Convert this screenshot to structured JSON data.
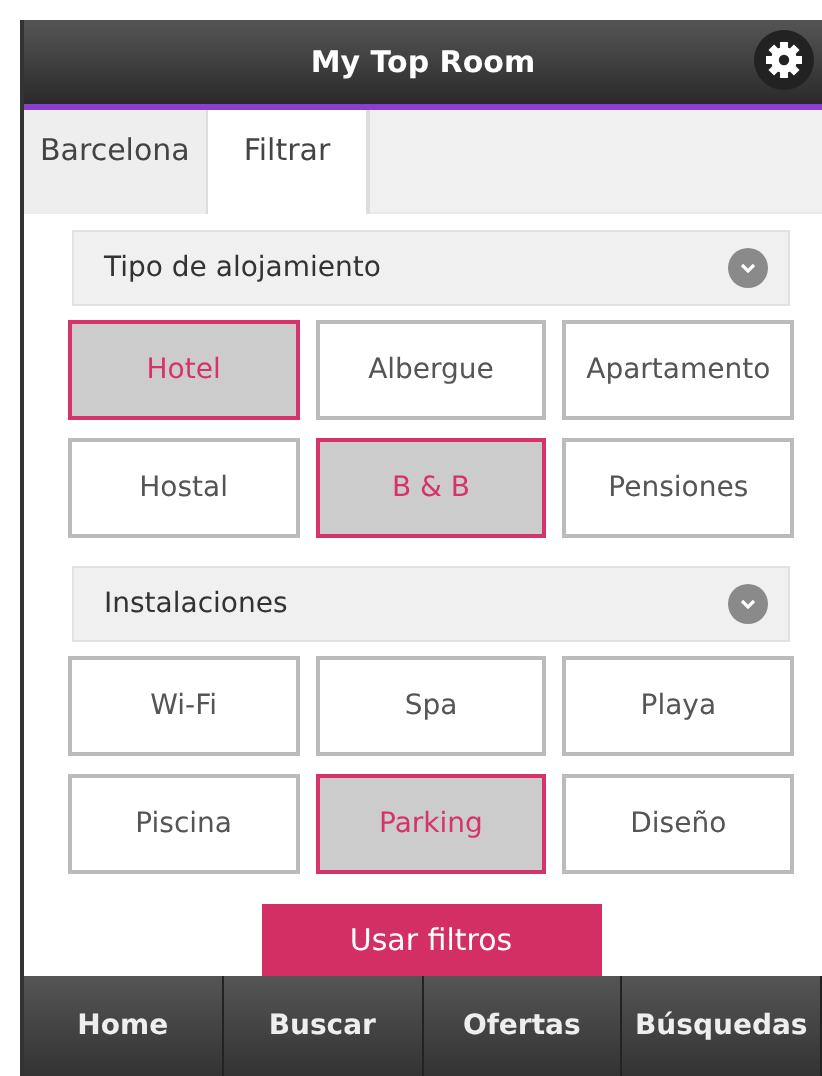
{
  "header": {
    "title": "My Top Room"
  },
  "tabs": [
    {
      "label": "Barcelona",
      "selected": false
    },
    {
      "label": "Filtrar",
      "selected": true
    }
  ],
  "sections": [
    {
      "title": "Tipo de alojamiento",
      "options": [
        {
          "label": "Hotel",
          "selected": true
        },
        {
          "label": "Albergue",
          "selected": false
        },
        {
          "label": "Apartamento",
          "selected": false
        },
        {
          "label": "Hostal",
          "selected": false
        },
        {
          "label": "B & B",
          "selected": true
        },
        {
          "label": "Pensiones",
          "selected": false
        }
      ]
    },
    {
      "title": "Instalaciones",
      "options": [
        {
          "label": "Wi-Fi",
          "selected": false
        },
        {
          "label": "Spa",
          "selected": false
        },
        {
          "label": "Playa",
          "selected": false
        },
        {
          "label": "Piscina",
          "selected": false
        },
        {
          "label": "Parking",
          "selected": true
        },
        {
          "label": "Diseño",
          "selected": false
        }
      ]
    }
  ],
  "apply_button": "Usar filtros",
  "bottom_nav": [
    "Home",
    "Buscar",
    "Ofertas",
    "Búsquedas"
  ]
}
